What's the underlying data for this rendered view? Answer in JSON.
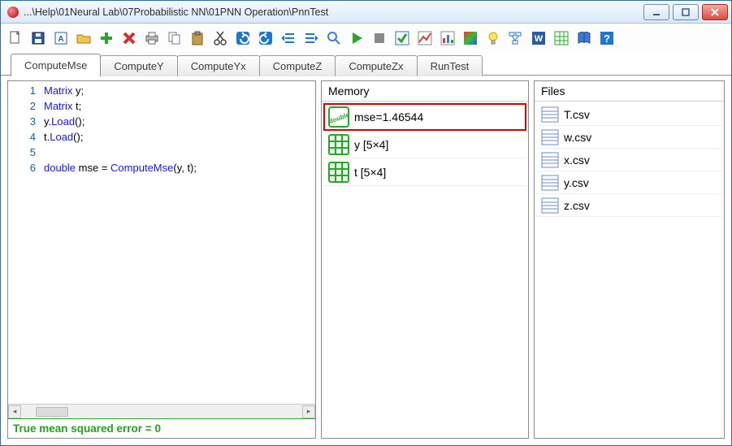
{
  "window": {
    "title": "...\\Help\\01Neural Lab\\07Probabilistic NN\\01PNN Operation\\PnnTest"
  },
  "toolbar_icons": [
    "new",
    "save",
    "save-all",
    "open",
    "add",
    "delete",
    "print",
    "copy",
    "paste",
    "cut",
    "undo",
    "redo",
    "outdent",
    "indent",
    "find",
    "run",
    "stop",
    "check",
    "chart-line",
    "chart-bars",
    "gradient",
    "bulb",
    "tree",
    "word",
    "excel",
    "book",
    "help"
  ],
  "tabs": [
    {
      "label": "ComputeMse",
      "active": true
    },
    {
      "label": "ComputeY",
      "active": false
    },
    {
      "label": "ComputeYx",
      "active": false
    },
    {
      "label": "ComputeZ",
      "active": false
    },
    {
      "label": "ComputeZx",
      "active": false
    },
    {
      "label": "RunTest",
      "active": false
    }
  ],
  "code": {
    "lines": [
      [
        {
          "t": "Matrix",
          "c": "kw-type"
        },
        {
          "t": " y;",
          "c": "plain"
        }
      ],
      [
        {
          "t": "Matrix",
          "c": "kw-type"
        },
        {
          "t": " t;",
          "c": "plain"
        }
      ],
      [
        {
          "t": "y.",
          "c": "plain"
        },
        {
          "t": "Load",
          "c": "kw-call"
        },
        {
          "t": "();",
          "c": "plain"
        }
      ],
      [
        {
          "t": "t.",
          "c": "plain"
        },
        {
          "t": "Load",
          "c": "kw-call"
        },
        {
          "t": "();",
          "c": "plain"
        }
      ],
      [],
      [
        {
          "t": "double",
          "c": "kw-type"
        },
        {
          "t": " mse = ",
          "c": "plain"
        },
        {
          "t": "ComputeMse",
          "c": "kw-call"
        },
        {
          "t": "(y, t);",
          "c": "plain"
        }
      ]
    ],
    "status": "True mean squared error = 0"
  },
  "memory": {
    "header": "Memory",
    "items": [
      {
        "icon": "double",
        "label": "mse=1.46544",
        "highlight": true
      },
      {
        "icon": "matrix",
        "label": "y [5×4]",
        "highlight": false
      },
      {
        "icon": "matrix",
        "label": "t [5×4]",
        "highlight": false
      }
    ]
  },
  "files": {
    "header": "Files",
    "items": [
      {
        "label": "T.csv"
      },
      {
        "label": "w.csv"
      },
      {
        "label": "x.csv"
      },
      {
        "label": "y.csv"
      },
      {
        "label": "z.csv"
      }
    ]
  }
}
